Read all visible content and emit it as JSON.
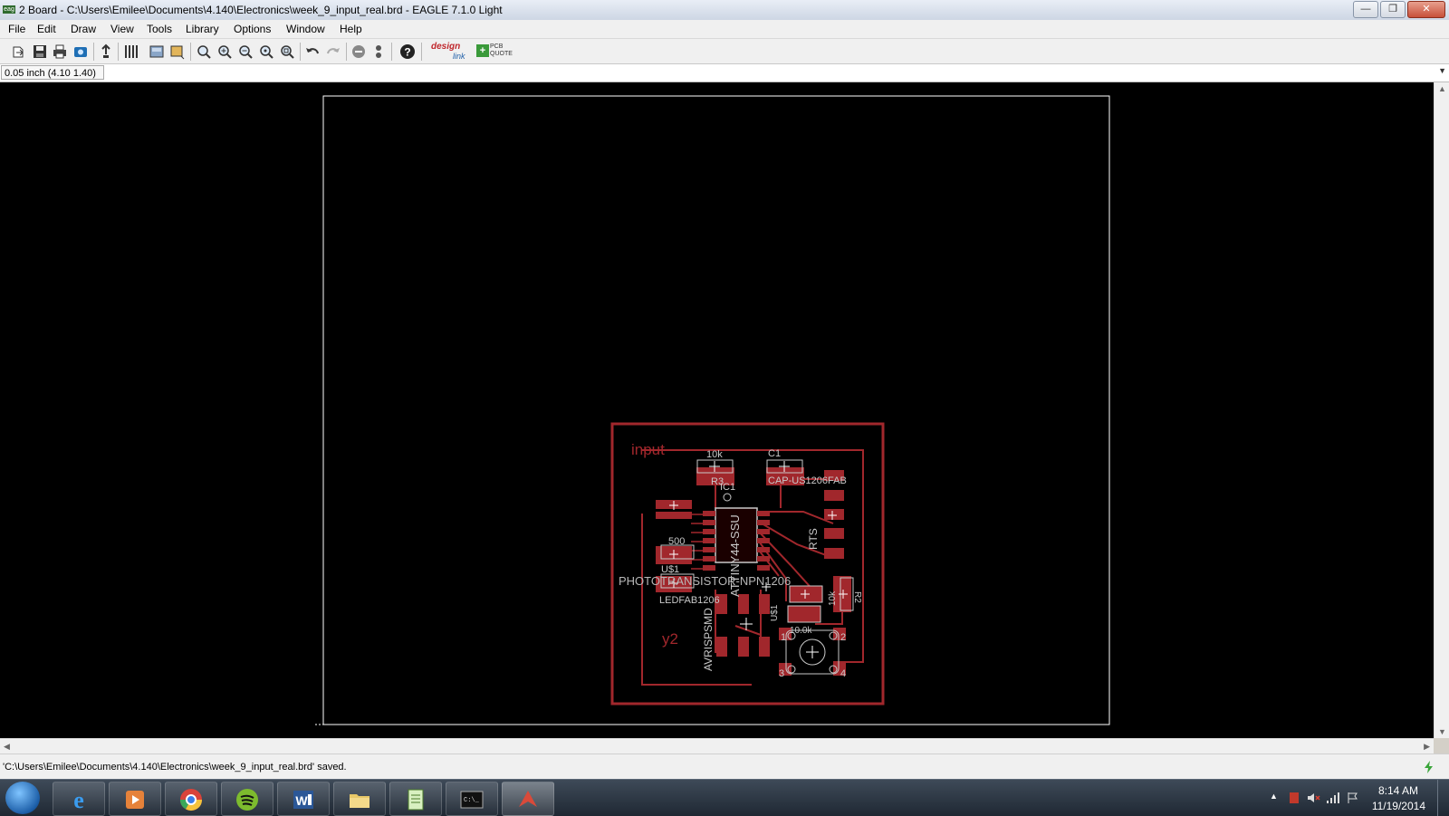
{
  "window": {
    "title": "2 Board - C:\\Users\\Emilee\\Documents\\4.140\\Electronics\\week_9_input_real.brd - EAGLE 7.1.0 Light",
    "app_icon_text": "eag",
    "minimize": "—",
    "maximize": "❐",
    "close": "✕"
  },
  "menu": {
    "items": [
      {
        "label": "File"
      },
      {
        "label": "Edit"
      },
      {
        "label": "Draw"
      },
      {
        "label": "View"
      },
      {
        "label": "Tools"
      },
      {
        "label": "Library"
      },
      {
        "label": "Options"
      },
      {
        "label": "Window"
      },
      {
        "label": "Help"
      }
    ]
  },
  "toolbar": {
    "design_link": {
      "part1": "design",
      "part2": "link"
    },
    "pcb_quote": {
      "line1": "PCB",
      "line2": "QUOTE"
    },
    "icons": [
      "open-icon",
      "save-icon",
      "print-icon",
      "cam-icon",
      "export-icon",
      "grid-icon",
      "layer-icon",
      "display-icon",
      "zoom-fit-icon",
      "zoom-in-icon",
      "zoom-out-icon",
      "zoom-redraw-icon",
      "zoom-select-icon",
      "undo-icon",
      "redo-icon",
      "stop-icon",
      "go-icon",
      "help-icon"
    ]
  },
  "coord": {
    "readout": "0.05 inch (4.10 1.40)",
    "command_placeholder": ""
  },
  "board": {
    "trace_color": "#a1272c",
    "frame_color": "#ffffff",
    "silk_color": "#b7b7b7",
    "labels": {
      "input": "input",
      "y2": "y2",
      "r3_value": "10k",
      "r3_name": "R3",
      "c1_name": "C1",
      "c1_value": "CAP-US1206FAB",
      "ic1_name": "IC1",
      "ic1_value": "ATTINY44-SSU",
      "rts": "RTS",
      "r_500": "500",
      "u_label": "U$1",
      "photo": "PHOTOTRANSISTOR-NPN1206",
      "led": "LEDFAB1206",
      "avr": "AVRISPSMD",
      "r2_value": "10k",
      "r2_name": "R2",
      "r_100k": "10.0k",
      "sw_1": "1",
      "sw_2": "2",
      "sw_3": "3",
      "sw_4": "4",
      "small": "U$1"
    }
  },
  "status": {
    "message": "'C:\\Users\\Emilee\\Documents\\4.140\\Electronics\\week_9_input_real.brd' saved."
  },
  "taskbar": {
    "apps": [
      "internet-explorer",
      "media-player",
      "chrome",
      "spotify",
      "word",
      "file-explorer",
      "notepad",
      "command-prompt",
      "eagle"
    ],
    "clock_time": "8:14 AM",
    "clock_date": "11/19/2014"
  }
}
